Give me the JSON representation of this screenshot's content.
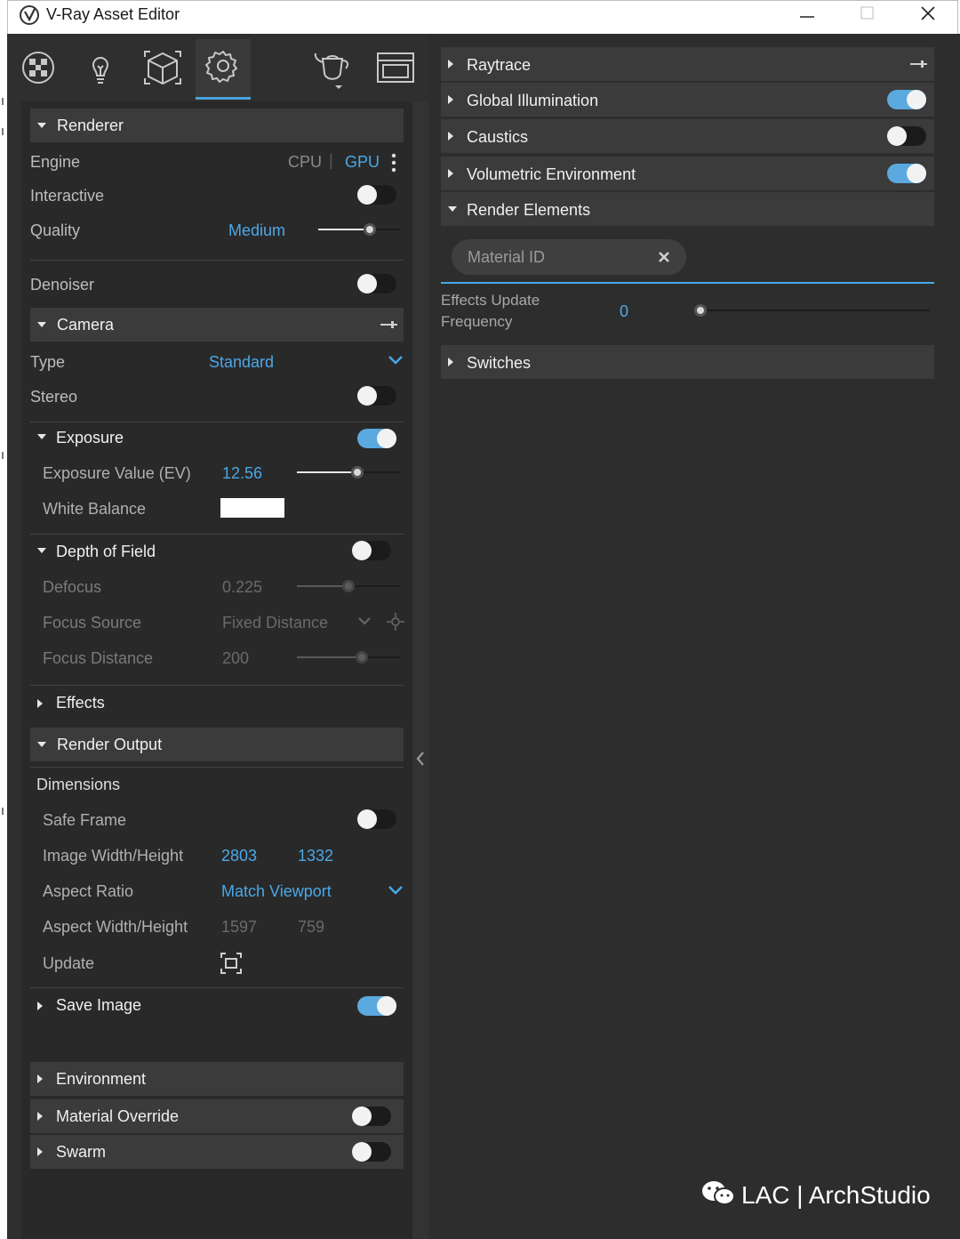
{
  "window": {
    "title": "V-Ray Asset Editor"
  },
  "icons": {
    "app": "vray-logo-icon",
    "minimize": "minimize-icon",
    "maximize": "maximize-icon",
    "close": "close-icon",
    "materials": "materials-icon",
    "lights": "lightbulb-icon",
    "geometry": "cube-icon",
    "settings": "gear-icon",
    "render": "teapot-icon",
    "frame_buffer": "frame-buffer-icon"
  },
  "left": {
    "renderer": {
      "title": "Renderer",
      "engine_label": "Engine",
      "engine_cpu": "CPU",
      "engine_sep": "|",
      "engine_gpu": "GPU",
      "interactive_label": "Interactive",
      "quality_label": "Quality",
      "quality_value": "Medium"
    },
    "denoiser_label": "Denoiser",
    "camera": {
      "title": "Camera",
      "type_label": "Type",
      "type_value": "Standard",
      "stereo_label": "Stereo"
    },
    "exposure": {
      "title": "Exposure",
      "ev_label": "Exposure Value (EV)",
      "ev_value": "12.56",
      "wb_label": "White Balance",
      "wb_color": "#ffffff"
    },
    "dof": {
      "title": "Depth of Field",
      "defocus_label": "Defocus",
      "defocus_value": "0.225",
      "focus_source_label": "Focus Source",
      "focus_source_value": "Fixed Distance",
      "focus_distance_label": "Focus Distance",
      "focus_distance_value": "200"
    },
    "effects_title": "Effects",
    "render_output": {
      "title": "Render Output",
      "dimensions": "Dimensions",
      "safe_frame_label": "Safe Frame",
      "image_wh_label": "Image Width/Height",
      "image_w": "2803",
      "image_h": "1332",
      "aspect_ratio_label": "Aspect Ratio",
      "aspect_ratio_value": "Match Viewport",
      "aspect_wh_label": "Aspect Width/Height",
      "aspect_w": "1597",
      "aspect_h": "759",
      "update_label": "Update"
    },
    "save_image": "Save Image",
    "environment": "Environment",
    "material_override": "Material Override",
    "swarm": "Swarm"
  },
  "right": {
    "raytrace": "Raytrace",
    "gi": "Global Illumination",
    "caustics": "Caustics",
    "volumetric": "Volumetric Environment",
    "render_elements": "Render Elements",
    "material_id_chip": "Material ID",
    "effects_update_line1": "Effects Update",
    "effects_update_line2": "Frequency",
    "effects_update_value": "0",
    "switches": "Switches"
  },
  "watermark": {
    "text": "LAC | ArchStudio"
  },
  "state": {
    "interactive": false,
    "denoiser": false,
    "stereo": false,
    "exposure": true,
    "dof": false,
    "safe_frame": false,
    "save_image": true,
    "material_override": false,
    "swarm": false,
    "gi": true,
    "caustics": false,
    "volumetric": true,
    "quality_level": 0.65,
    "ev_level": 0.6,
    "defocus_level": 0.5,
    "focus_distance_level": 0.65,
    "effects_update_level": 0.0
  },
  "colors": {
    "accent": "#4aa8e8",
    "panel": "#2f2f2f",
    "section": "#3b3b3b"
  }
}
